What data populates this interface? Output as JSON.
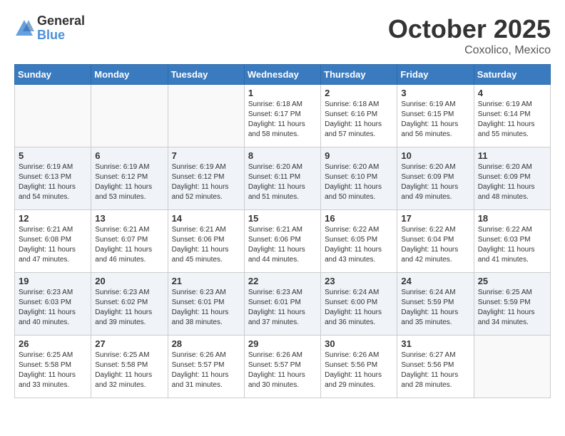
{
  "header": {
    "logo_line1": "General",
    "logo_line2": "Blue",
    "month": "October 2025",
    "location": "Coxolico, Mexico"
  },
  "weekdays": [
    "Sunday",
    "Monday",
    "Tuesday",
    "Wednesday",
    "Thursday",
    "Friday",
    "Saturday"
  ],
  "weeks": [
    [
      {
        "day": "",
        "info": ""
      },
      {
        "day": "",
        "info": ""
      },
      {
        "day": "",
        "info": ""
      },
      {
        "day": "1",
        "info": "Sunrise: 6:18 AM\nSunset: 6:17 PM\nDaylight: 11 hours\nand 58 minutes."
      },
      {
        "day": "2",
        "info": "Sunrise: 6:18 AM\nSunset: 6:16 PM\nDaylight: 11 hours\nand 57 minutes."
      },
      {
        "day": "3",
        "info": "Sunrise: 6:19 AM\nSunset: 6:15 PM\nDaylight: 11 hours\nand 56 minutes."
      },
      {
        "day": "4",
        "info": "Sunrise: 6:19 AM\nSunset: 6:14 PM\nDaylight: 11 hours\nand 55 minutes."
      }
    ],
    [
      {
        "day": "5",
        "info": "Sunrise: 6:19 AM\nSunset: 6:13 PM\nDaylight: 11 hours\nand 54 minutes."
      },
      {
        "day": "6",
        "info": "Sunrise: 6:19 AM\nSunset: 6:12 PM\nDaylight: 11 hours\nand 53 minutes."
      },
      {
        "day": "7",
        "info": "Sunrise: 6:19 AM\nSunset: 6:12 PM\nDaylight: 11 hours\nand 52 minutes."
      },
      {
        "day": "8",
        "info": "Sunrise: 6:20 AM\nSunset: 6:11 PM\nDaylight: 11 hours\nand 51 minutes."
      },
      {
        "day": "9",
        "info": "Sunrise: 6:20 AM\nSunset: 6:10 PM\nDaylight: 11 hours\nand 50 minutes."
      },
      {
        "day": "10",
        "info": "Sunrise: 6:20 AM\nSunset: 6:09 PM\nDaylight: 11 hours\nand 49 minutes."
      },
      {
        "day": "11",
        "info": "Sunrise: 6:20 AM\nSunset: 6:09 PM\nDaylight: 11 hours\nand 48 minutes."
      }
    ],
    [
      {
        "day": "12",
        "info": "Sunrise: 6:21 AM\nSunset: 6:08 PM\nDaylight: 11 hours\nand 47 minutes."
      },
      {
        "day": "13",
        "info": "Sunrise: 6:21 AM\nSunset: 6:07 PM\nDaylight: 11 hours\nand 46 minutes."
      },
      {
        "day": "14",
        "info": "Sunrise: 6:21 AM\nSunset: 6:06 PM\nDaylight: 11 hours\nand 45 minutes."
      },
      {
        "day": "15",
        "info": "Sunrise: 6:21 AM\nSunset: 6:06 PM\nDaylight: 11 hours\nand 44 minutes."
      },
      {
        "day": "16",
        "info": "Sunrise: 6:22 AM\nSunset: 6:05 PM\nDaylight: 11 hours\nand 43 minutes."
      },
      {
        "day": "17",
        "info": "Sunrise: 6:22 AM\nSunset: 6:04 PM\nDaylight: 11 hours\nand 42 minutes."
      },
      {
        "day": "18",
        "info": "Sunrise: 6:22 AM\nSunset: 6:03 PM\nDaylight: 11 hours\nand 41 minutes."
      }
    ],
    [
      {
        "day": "19",
        "info": "Sunrise: 6:23 AM\nSunset: 6:03 PM\nDaylight: 11 hours\nand 40 minutes."
      },
      {
        "day": "20",
        "info": "Sunrise: 6:23 AM\nSunset: 6:02 PM\nDaylight: 11 hours\nand 39 minutes."
      },
      {
        "day": "21",
        "info": "Sunrise: 6:23 AM\nSunset: 6:01 PM\nDaylight: 11 hours\nand 38 minutes."
      },
      {
        "day": "22",
        "info": "Sunrise: 6:23 AM\nSunset: 6:01 PM\nDaylight: 11 hours\nand 37 minutes."
      },
      {
        "day": "23",
        "info": "Sunrise: 6:24 AM\nSunset: 6:00 PM\nDaylight: 11 hours\nand 36 minutes."
      },
      {
        "day": "24",
        "info": "Sunrise: 6:24 AM\nSunset: 5:59 PM\nDaylight: 11 hours\nand 35 minutes."
      },
      {
        "day": "25",
        "info": "Sunrise: 6:25 AM\nSunset: 5:59 PM\nDaylight: 11 hours\nand 34 minutes."
      }
    ],
    [
      {
        "day": "26",
        "info": "Sunrise: 6:25 AM\nSunset: 5:58 PM\nDaylight: 11 hours\nand 33 minutes."
      },
      {
        "day": "27",
        "info": "Sunrise: 6:25 AM\nSunset: 5:58 PM\nDaylight: 11 hours\nand 32 minutes."
      },
      {
        "day": "28",
        "info": "Sunrise: 6:26 AM\nSunset: 5:57 PM\nDaylight: 11 hours\nand 31 minutes."
      },
      {
        "day": "29",
        "info": "Sunrise: 6:26 AM\nSunset: 5:57 PM\nDaylight: 11 hours\nand 30 minutes."
      },
      {
        "day": "30",
        "info": "Sunrise: 6:26 AM\nSunset: 5:56 PM\nDaylight: 11 hours\nand 29 minutes."
      },
      {
        "day": "31",
        "info": "Sunrise: 6:27 AM\nSunset: 5:56 PM\nDaylight: 11 hours\nand 28 minutes."
      },
      {
        "day": "",
        "info": ""
      }
    ]
  ]
}
